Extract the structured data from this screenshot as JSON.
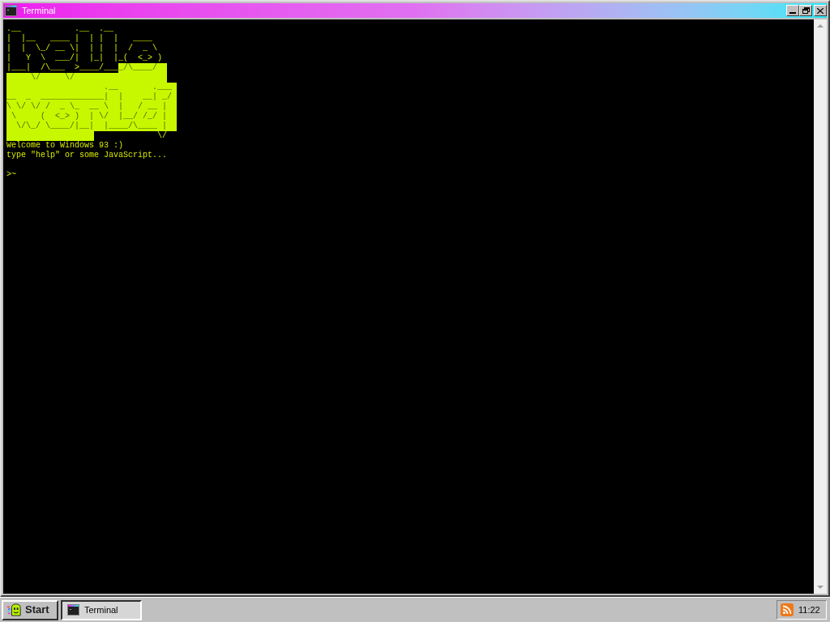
{
  "window": {
    "title": "Terminal"
  },
  "terminal": {
    "art_lines": [
      {
        "segments": [
          {
            "kind": "text",
            "text": ".__           .__  .__",
            "selected": false
          }
        ]
      },
      {
        "segments": [
          {
            "kind": "text",
            "text": "|  |__   ____ |  | |  |   ____",
            "selected": false
          }
        ]
      },
      {
        "segments": [
          {
            "kind": "text",
            "text": "|  |  \\_/ __ \\|  | |  |  /  _ \\",
            "selected": false
          }
        ]
      },
      {
        "segments": [
          {
            "kind": "text",
            "text": "|   Y  \\  ___/|  |_|  |_(  <_> )",
            "selected": false
          }
        ]
      },
      {
        "segments": [
          {
            "kind": "text",
            "text": "|___|  /\\___  >____/___",
            "selected": false
          },
          {
            "kind": "text",
            "text": "_/\\____/  ",
            "selected": true
          }
        ]
      },
      {
        "segments": [
          {
            "kind": "text",
            "text": "     \\/     \\/                   ",
            "selected": true
          }
        ]
      },
      {
        "segments": [
          {
            "kind": "text",
            "text": "                    .__       .___ ",
            "selected": true
          }
        ]
      },
      {
        "segments": [
          {
            "kind": "text",
            "text": "__  _  _____________|  |    __| _/ ",
            "selected": true
          }
        ]
      },
      {
        "segments": [
          {
            "kind": "text",
            "text": "\\ \\/ \\/ /  _ \\_  __ \\  |   / __ |  ",
            "selected": true
          }
        ]
      },
      {
        "segments": [
          {
            "kind": "text",
            "text": " \\     (  <_> )  | \\/  |__/ /_/ |  ",
            "selected": true
          }
        ]
      },
      {
        "segments": [
          {
            "kind": "text",
            "text": "  \\/\\_/ \\____/|__|  |____/\\____ |  ",
            "selected": true
          }
        ]
      },
      {
        "segments": [
          {
            "kind": "blank",
            "selected": true
          },
          {
            "kind": "text",
            "text": "             \\/",
            "selected": false
          }
        ]
      }
    ],
    "lines": [
      "Welcome to Windows 93 :)",
      "type \"help\" or some JavaScript..."
    ],
    "prompt": ">~"
  },
  "taskbar": {
    "start_button": "Start",
    "tasks": [
      {
        "label": "Terminal",
        "selected": true
      }
    ],
    "clock": "11:22"
  }
}
